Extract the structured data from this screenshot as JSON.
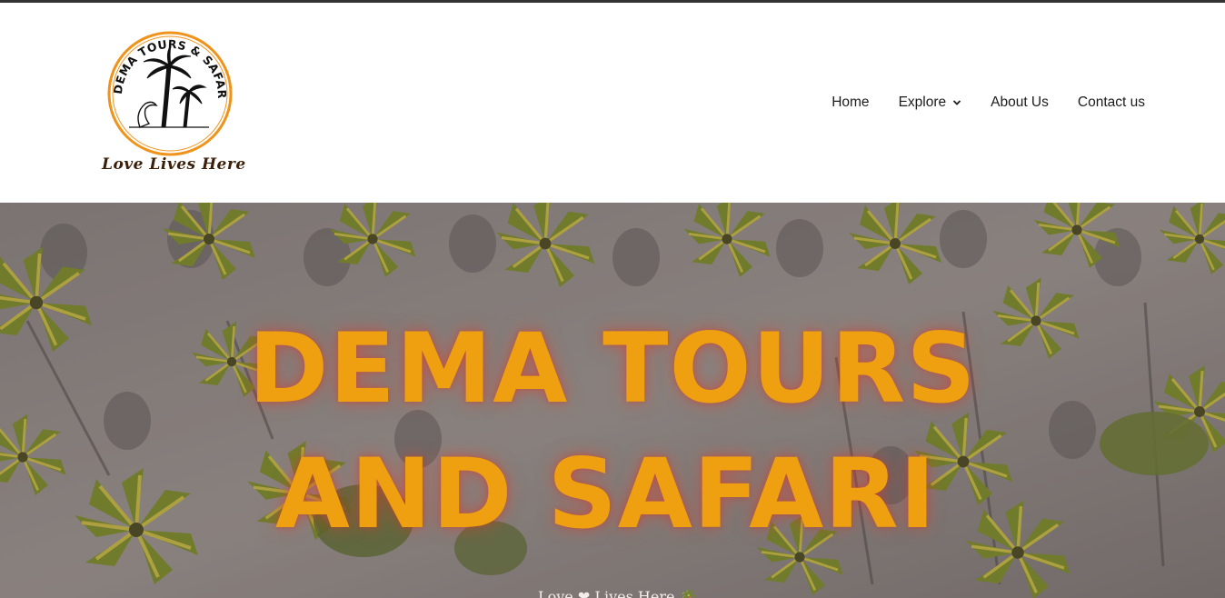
{
  "brand": {
    "ring_text": "DEMA TOURS & SAFARI",
    "tagline": "Love  Lives Here",
    "ring_color": "#f0931b"
  },
  "nav": {
    "items": [
      {
        "label": "Home"
      },
      {
        "label": "Explore",
        "icon": "chevron-down-icon"
      },
      {
        "label": "About Us"
      },
      {
        "label": "Contact us"
      }
    ]
  },
  "hero": {
    "title_line1": "DEMA TOURS",
    "title_line2": "AND SAFARI",
    "subtitle": "Love ❤ Lives Here 🌴",
    "title_color": "#eea011"
  }
}
